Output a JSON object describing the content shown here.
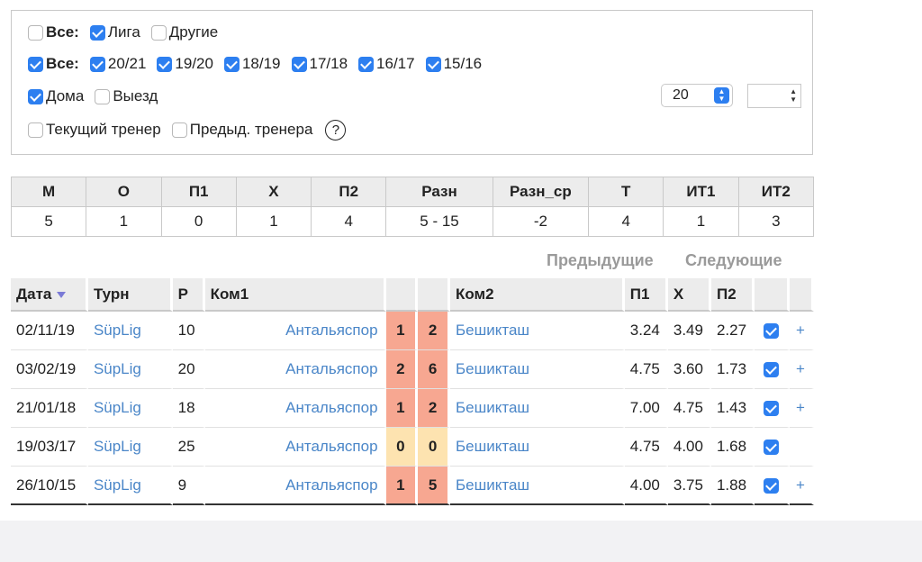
{
  "filters": {
    "row1": {
      "all_label": "Все:",
      "all_checked": false,
      "options": [
        {
          "label": "Лига",
          "checked": true
        },
        {
          "label": "Другие",
          "checked": false
        }
      ]
    },
    "row2": {
      "all_label": "Все:",
      "all_checked": true,
      "options": [
        {
          "label": "20/21",
          "checked": true
        },
        {
          "label": "19/20",
          "checked": true
        },
        {
          "label": "18/19",
          "checked": true
        },
        {
          "label": "17/18",
          "checked": true
        },
        {
          "label": "16/17",
          "checked": true
        },
        {
          "label": "15/16",
          "checked": true
        }
      ]
    },
    "row3": {
      "options": [
        {
          "label": "Дома",
          "checked": true
        },
        {
          "label": "Выезд",
          "checked": false
        }
      ]
    },
    "row4": {
      "options": [
        {
          "label": "Текущий тренер",
          "checked": false
        },
        {
          "label": "Предыд. тренера",
          "checked": false
        }
      ],
      "help": "?"
    },
    "limit_select": "20",
    "stepper_value": ""
  },
  "stats": {
    "headers": [
      "М",
      "О",
      "П1",
      "Х",
      "П2",
      "Разн",
      "Разн_ср",
      "Т",
      "ИТ1",
      "ИТ2"
    ],
    "values": [
      "5",
      "1",
      "0",
      "1",
      "4",
      "5 - 15",
      "-2",
      "4",
      "1",
      "3"
    ]
  },
  "nav": {
    "prev": "Предыдущие",
    "next": "Следующие"
  },
  "matches": {
    "headers": {
      "date": "Дата",
      "tournament": "Турн",
      "round": "Р",
      "team1": "Ком1",
      "team2": "Ком2",
      "p1": "П1",
      "x": "Х",
      "p2": "П2"
    },
    "rows": [
      {
        "date": "02/11/19",
        "tournament": "SüpLig",
        "round": "10",
        "team1": "Антальяспор",
        "score1": "1",
        "score2": "2",
        "team2": "Бешикташ",
        "p1": "3.24",
        "x": "3.49",
        "p2": "2.27",
        "checked": true,
        "plus": "+",
        "result": "loss"
      },
      {
        "date": "03/02/19",
        "tournament": "SüpLig",
        "round": "20",
        "team1": "Антальяспор",
        "score1": "2",
        "score2": "6",
        "team2": "Бешикташ",
        "p1": "4.75",
        "x": "3.60",
        "p2": "1.73",
        "checked": true,
        "plus": "+",
        "result": "loss"
      },
      {
        "date": "21/01/18",
        "tournament": "SüpLig",
        "round": "18",
        "team1": "Антальяспор",
        "score1": "1",
        "score2": "2",
        "team2": "Бешикташ",
        "p1": "7.00",
        "x": "4.75",
        "p2": "1.43",
        "checked": true,
        "plus": "+",
        "result": "loss"
      },
      {
        "date": "19/03/17",
        "tournament": "SüpLig",
        "round": "25",
        "team1": "Антальяспор",
        "score1": "0",
        "score2": "0",
        "team2": "Бешикташ",
        "p1": "4.75",
        "x": "4.00",
        "p2": "1.68",
        "checked": true,
        "plus": "",
        "result": "draw"
      },
      {
        "date": "26/10/15",
        "tournament": "SüpLig",
        "round": "9",
        "team1": "Антальяспор",
        "score1": "1",
        "score2": "5",
        "team2": "Бешикташ",
        "p1": "4.00",
        "x": "3.75",
        "p2": "1.88",
        "checked": true,
        "plus": "+",
        "result": "loss"
      }
    ]
  }
}
